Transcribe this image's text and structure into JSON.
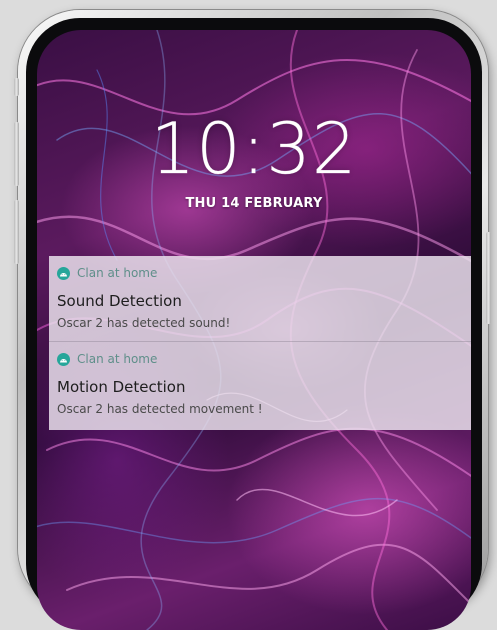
{
  "lockscreen": {
    "time_hour": "10",
    "time_sep": ":",
    "time_minute": "32",
    "date": "THU 14 FEBRUARY"
  },
  "notifications": [
    {
      "app_name": "Clan at home",
      "app_icon": "android-icon",
      "title": "Sound Detection",
      "body": "Oscar 2 has detected sound!"
    },
    {
      "app_name": "Clan at home",
      "app_icon": "android-icon",
      "title": "Motion Detection",
      "body": "Oscar 2 has detected movement !"
    }
  ],
  "colors": {
    "app_icon": "#26a69a",
    "notification_bg": "#ece4ee"
  }
}
